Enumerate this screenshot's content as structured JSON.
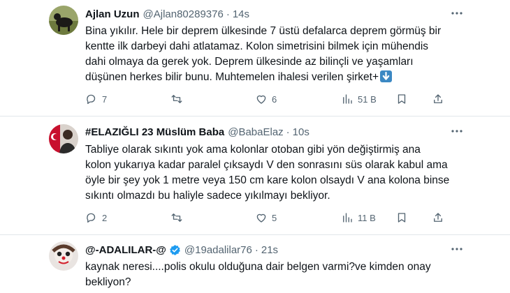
{
  "tweets": [
    {
      "name": "Ajlan Uzun",
      "handle": "@Ajlan80289376",
      "time": "14s",
      "lines": [
        "Bina yıkılır. Hele bir deprem ülkesinde 7 üstü defalarca deprem görmüş bir",
        "kentte ilk darbeyi dahi atlatamaz. Kolon simetrisini bilmek için mühendis",
        "dahi olmaya da gerek yok. Deprem ülkesinde az bilinçli ve yaşamları",
        "düşünen herkes bilir bunu. Muhtemelen ihalesi verilen şirket+"
      ],
      "emoji": "down-arrow-emoji",
      "replies": "7",
      "retweets": "",
      "likes": "6",
      "views": "51 B"
    },
    {
      "name": "#ELAZIĞLI 23 Müslüm Baba",
      "handle": "@BabaElaz",
      "time": "10s",
      "lines": [
        "Tabliye olarak sıkıntı yok ama kolonlar otoban gibi yön değiştirmiş ana",
        "kolon yukarıya kadar paralel çıksaydı V den sonrasını süs olarak kabul  ama",
        "öyle bir şey yok 1 metre veya 150 cm kare kolon olsaydı V ana kolona binse",
        "sıkıntı olmazdı bu haliyle sadece yıkılmayı bekliyor."
      ],
      "replies": "2",
      "retweets": "",
      "likes": "5",
      "views": "11 B"
    },
    {
      "name": "@-ADALILAR-@",
      "handle": "@19adalilar76",
      "time": "21s",
      "verified": true,
      "lines": [
        "kaynak neresi....polis okulu olduğuna dair belgen varmi?ve kimden onay",
        "bekliyon?"
      ]
    }
  ],
  "sep": "·",
  "colors": {
    "text": "#0f1419",
    "muted": "#536471",
    "divider": "#e1e6ea",
    "verified": "#1d9bf0"
  }
}
